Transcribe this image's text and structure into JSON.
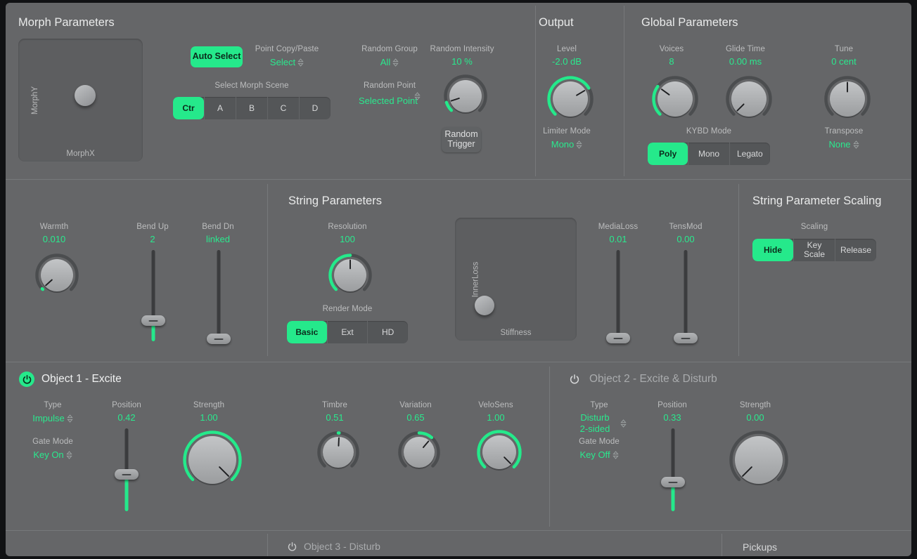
{
  "accent": "#25e98b",
  "panel_bg": "#656668",
  "morph": {
    "title": "Morph Parameters",
    "pad": {
      "x_label": "MorphX",
      "y_label": "MorphY"
    },
    "auto_select": "Auto Select",
    "point_copy_paste": {
      "label": "Point Copy/Paste",
      "value": "Select"
    },
    "select_morph_scene": {
      "label": "Select Morph Scene",
      "options": [
        "Ctr",
        "A",
        "B",
        "C",
        "D"
      ],
      "selected": "Ctr"
    },
    "random_group": {
      "label": "Random Group",
      "value": "All"
    },
    "random_point": {
      "label": "Random Point",
      "value": "Selected Point"
    },
    "random_intensity": {
      "label": "Random Intensity",
      "value": "10 %"
    },
    "random_trigger": "Random\nTrigger"
  },
  "output": {
    "title": "Output",
    "level": {
      "label": "Level",
      "value": "-2.0 dB"
    },
    "limiter_mode": {
      "label": "Limiter Mode",
      "value": "Mono"
    }
  },
  "global": {
    "title": "Global Parameters",
    "voices": {
      "label": "Voices",
      "value": "8"
    },
    "glide_time": {
      "label": "Glide Time",
      "value": "0.00 ms"
    },
    "tune": {
      "label": "Tune",
      "value": "0 cent"
    },
    "kybd_mode": {
      "label": "KYBD Mode",
      "options": [
        "Poly",
        "Mono",
        "Legato"
      ],
      "selected": "Poly"
    },
    "transpose": {
      "label": "Transpose",
      "value": "None"
    }
  },
  "string": {
    "title": "String Parameters",
    "warmth": {
      "label": "Warmth",
      "value": "0.010"
    },
    "bend_up": {
      "label": "Bend Up",
      "value": "2"
    },
    "bend_dn": {
      "label": "Bend Dn",
      "value": "linked"
    },
    "resolution": {
      "label": "Resolution",
      "value": "100"
    },
    "render_mode": {
      "label": "Render Mode",
      "options": [
        "Basic",
        "Ext",
        "HD"
      ],
      "selected": "Basic"
    },
    "pad": {
      "x_label": "Stiffness",
      "y_label": "InnerLoss"
    },
    "media_loss": {
      "label": "MediaLoss",
      "value": "0.01"
    },
    "tens_mod": {
      "label": "TensMod",
      "value": "0.00"
    }
  },
  "scaling": {
    "title": "String Parameter Scaling",
    "label": "Scaling",
    "options": [
      "Hide",
      "Key\nScale",
      "Release"
    ],
    "selected": "Hide"
  },
  "object1": {
    "title": "Object 1 - Excite",
    "power": "on",
    "type": {
      "label": "Type",
      "value": "Impulse"
    },
    "gate_mode": {
      "label": "Gate Mode",
      "value": "Key On"
    },
    "position": {
      "label": "Position",
      "value": "0.42"
    },
    "strength": {
      "label": "Strength",
      "value": "1.00"
    },
    "timbre": {
      "label": "Timbre",
      "value": "0.51"
    },
    "variation": {
      "label": "Variation",
      "value": "0.65"
    },
    "velosens": {
      "label": "VeloSens",
      "value": "1.00"
    }
  },
  "object2": {
    "title": "Object 2 - Excite & Disturb",
    "power": "off",
    "type": {
      "label": "Type",
      "value": "Disturb\n2-sided"
    },
    "gate_mode": {
      "label": "Gate Mode",
      "value": "Key Off"
    },
    "position": {
      "label": "Position",
      "value": "0.33"
    },
    "strength": {
      "label": "Strength",
      "value": "0.00"
    }
  },
  "object3": {
    "title": "Object 3 - Disturb",
    "power": "off"
  },
  "pickups": {
    "title": "Pickups"
  }
}
